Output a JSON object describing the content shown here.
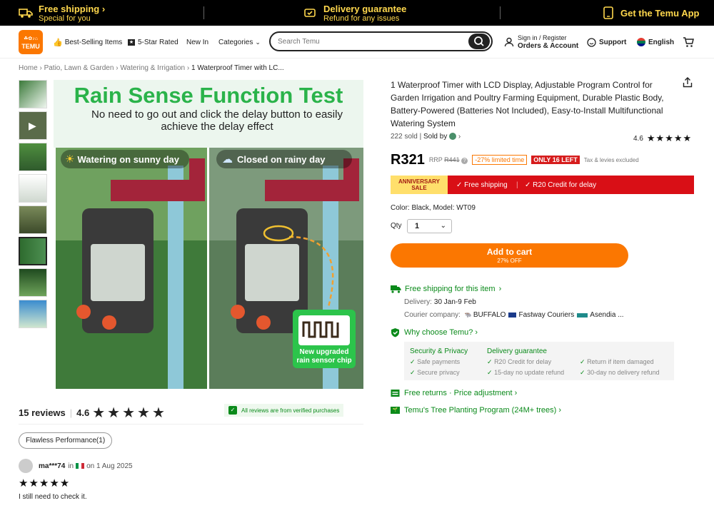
{
  "topbar": {
    "ship_title": "Free shipping",
    "ship_sub": "Special for you",
    "delivery_title": "Delivery guarantee",
    "delivery_sub": "Refund for any issues",
    "app": "Get the Temu App"
  },
  "header": {
    "logo": "TEMU",
    "nav": [
      "Best-Selling Items",
      "5-Star Rated",
      "New In",
      "Categories"
    ],
    "search_placeholder": "Search Temu",
    "signin": "Sign in / Register",
    "orders": "Orders & Account",
    "support": "Support",
    "language": "English"
  },
  "breadcrumb": [
    "Home",
    "Patio, Lawn & Garden",
    "Watering & Irrigation",
    "1 Waterproof Timer with LC..."
  ],
  "hero": {
    "headline": "Rain Sense Function Test",
    "sub": "No need to go out and click the delay button to easily achieve the delay effect",
    "left_label": "Watering on sunny day",
    "right_label": "Closed on rainy day",
    "chip_label": "New upgraded rain sensor chip"
  },
  "product": {
    "title": "1 Waterproof Timer with LCD Display, Adjustable Program Control for Garden Irrigation and Poultry Farming Equipment, Durable Plastic Body, Battery-Powered (Batteries Not Included), Easy-to-Install Multifunctional Watering System",
    "sold": "222 sold",
    "sold_by": "Sold by",
    "rating": "4.6",
    "price": "R321",
    "rrp_label": "RRP",
    "rrp_value": "R441",
    "discount": "-27% limited time",
    "stock": "ONLY 16 LEFT",
    "tax": "Tax & levies excluded"
  },
  "anniversary": {
    "tag": "ANNIVERSARY SALE",
    "free_shipping": "✓ Free shipping",
    "credit": "✓ R20 Credit for delay"
  },
  "variant": "Color: Black, Model: WT09",
  "qty": {
    "label": "Qty",
    "value": "1"
  },
  "cart": {
    "label": "Add to cart",
    "sub": "27% OFF"
  },
  "shipping": {
    "title": "Free shipping for this item",
    "delivery_label": "Delivery:",
    "delivery_value": "30 Jan-9 Feb",
    "courier_label": "Courier company:",
    "couriers": [
      "BUFFALO",
      "Fastway Couriers",
      "Asendia ..."
    ]
  },
  "why": {
    "title": "Why choose Temu?",
    "security_title": "Security & Privacy",
    "security_items": [
      "Safe payments",
      "Secure privacy"
    ],
    "delivery_title": "Delivery guarantee",
    "delivery_items": [
      "R20 Credit for delay",
      "15-day no update refund",
      "Return if item damaged",
      "30-day no delivery refund"
    ]
  },
  "returns": "Free returns · Price adjustment",
  "tree": "Temu's Tree Planting Program (24M+ trees)",
  "reviews": {
    "count": "15 reviews",
    "rating": "4.6",
    "verified": "All reviews are from verified purchases",
    "chip": "Flawless Performance(1)",
    "reviewer": "ma***74",
    "in": "in",
    "date": "on 1 Aug 2025",
    "text": "I still need to check it."
  },
  "colors": {
    "accent": "#fb7701",
    "green": "#0a8a1a",
    "red": "#d90f16"
  }
}
